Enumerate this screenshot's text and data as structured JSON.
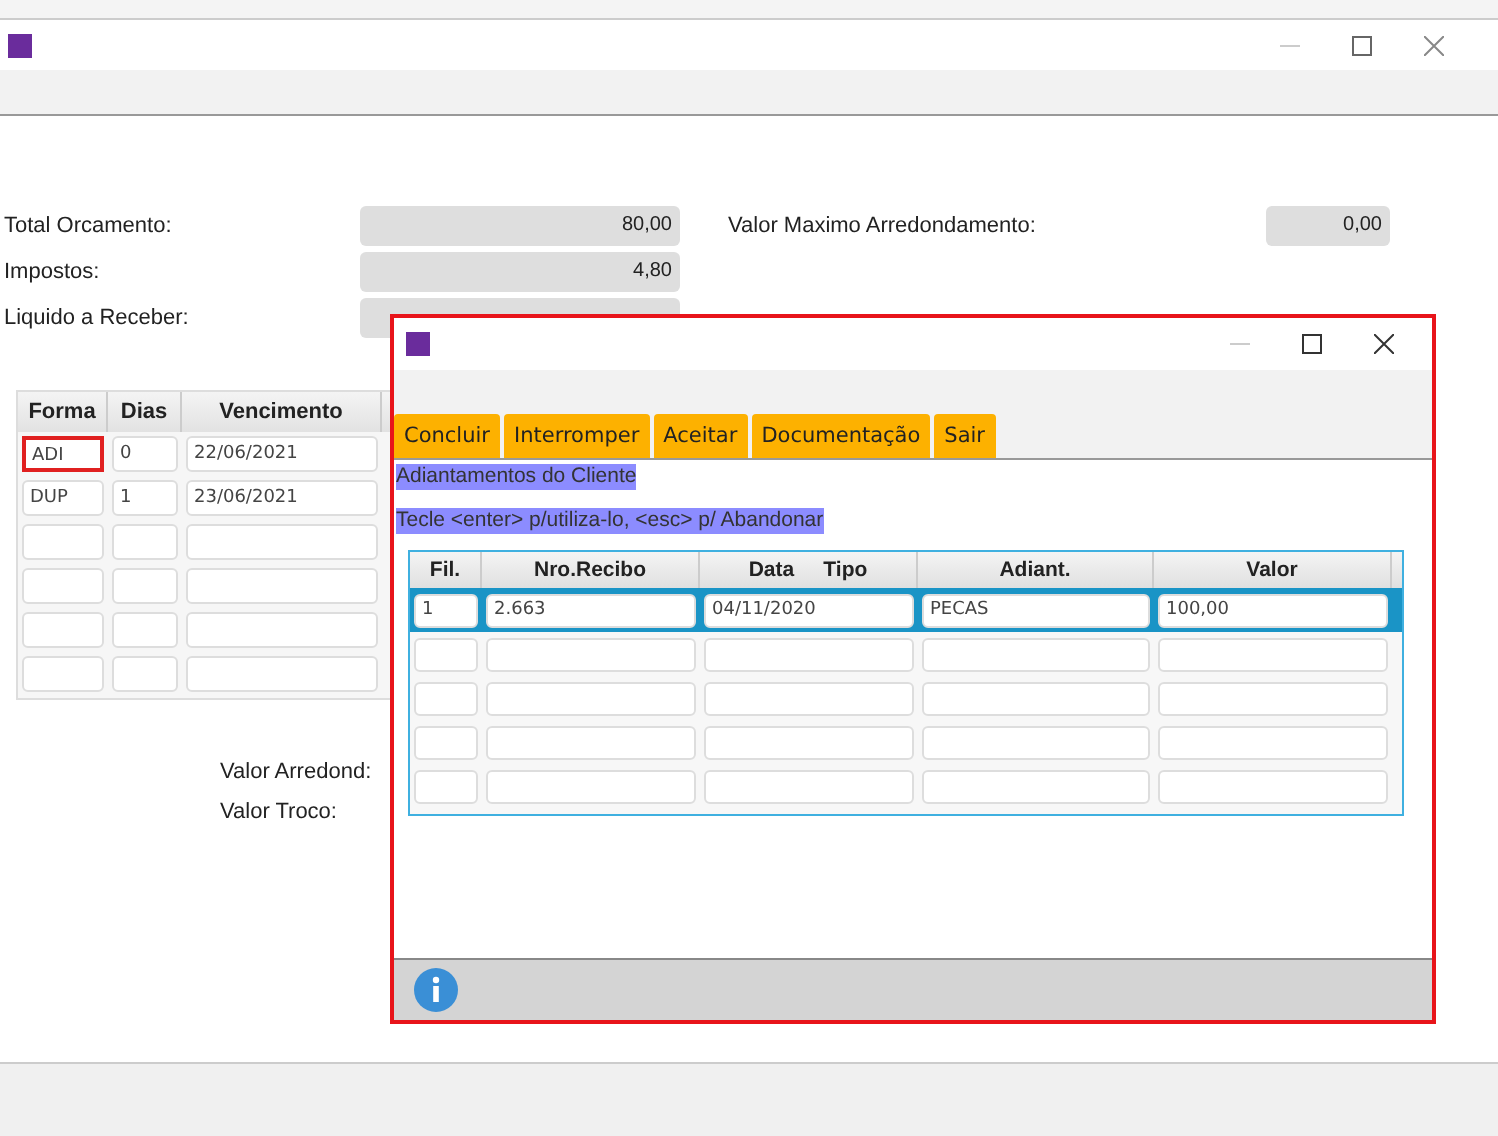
{
  "summary": [
    {
      "label": "Total Orcamento:",
      "value": "80,00"
    },
    {
      "label": "Impostos:",
      "value": "4,80"
    },
    {
      "label": "Liquido a Receber:"
    }
  ],
  "rounding": {
    "label": "Valor Maximo Arredondamento:",
    "value": "0,00"
  },
  "installments": {
    "columns": [
      "Forma",
      "Dias",
      "Vencimento"
    ],
    "rows": [
      {
        "cells": [
          "ADI",
          "0",
          "22/06/2021"
        ],
        "selected": true
      },
      {
        "cells": [
          "DUP",
          "1",
          "23/06/2021"
        ],
        "selected": false
      }
    ]
  },
  "totals_labels": [
    "Valor Arredond:",
    "Valor Troco:"
  ],
  "dialog": {
    "buttons": [
      "Concluir",
      "Interromper",
      "Aceitar",
      "Documentação",
      "Sair"
    ],
    "title": "Adiantamentos do Cliente",
    "hint": "Tecle <enter> p/utiliza-lo, <esc> p/ Abandonar",
    "table": {
      "columns": [
        "Fil.",
        "Nro.Recibo",
        "Data     Tipo",
        "Adiant.",
        "Valor"
      ],
      "rows": [
        {
          "cells": [
            "1",
            "2.663",
            "04/11/2020",
            "PECAS",
            "100,00"
          ],
          "selected": true
        }
      ]
    }
  }
}
